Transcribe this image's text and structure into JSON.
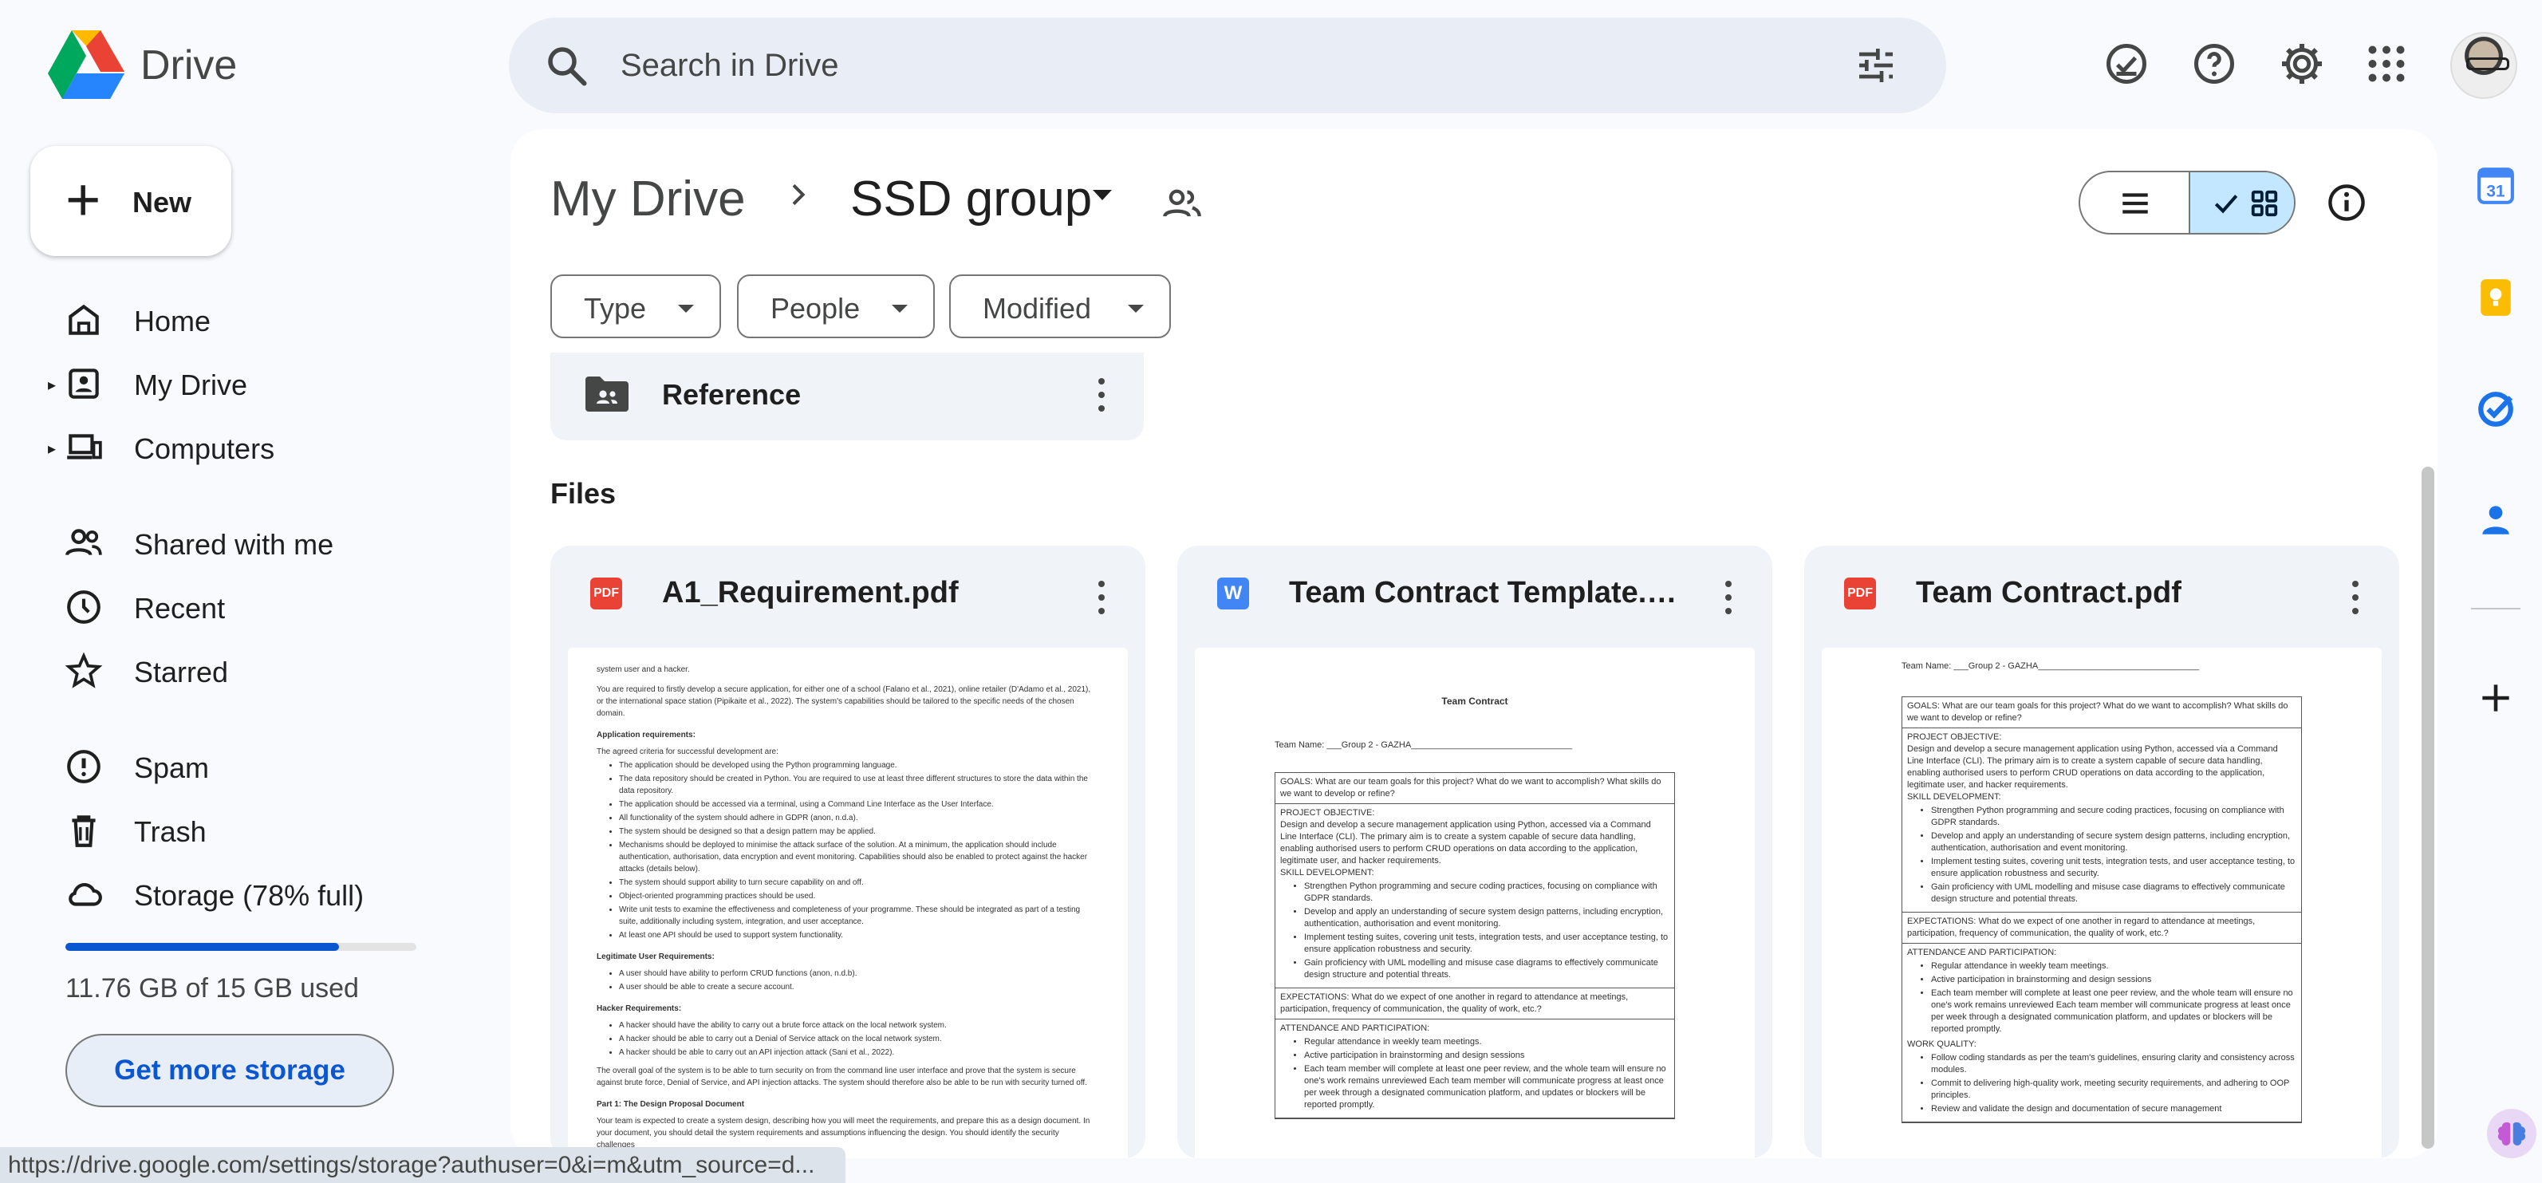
{
  "app": {
    "brand": "Drive"
  },
  "search": {
    "placeholder": "Search in Drive"
  },
  "sidebar": {
    "new_label": "New",
    "items": [
      {
        "label": "Home"
      },
      {
        "label": "My Drive"
      },
      {
        "label": "Computers"
      },
      {
        "label": "Shared with me"
      },
      {
        "label": "Recent"
      },
      {
        "label": "Starred"
      },
      {
        "label": "Spam"
      },
      {
        "label": "Trash"
      },
      {
        "label": "Storage (78% full)"
      }
    ],
    "storage_used_text": "11.76 GB of 15 GB used",
    "storage_percent": 78,
    "get_storage_label": "Get more storage"
  },
  "breadcrumb": {
    "root": "My Drive",
    "current": "SSD group"
  },
  "filters": {
    "type": "Type",
    "people": "People",
    "modified": "Modified"
  },
  "folder": {
    "name": "Reference"
  },
  "files_heading": "Files",
  "files": [
    {
      "name": "A1_Requirement.pdf",
      "kind": "PDF"
    },
    {
      "name": "Team Contract Template.do...",
      "kind": "W"
    },
    {
      "name": "Team Contract.pdf",
      "kind": "PDF"
    }
  ],
  "preview_a1": {
    "p1": "system user and a hacker.",
    "p2": "You are required to firstly develop a secure application, for either one of a school (Falano et al., 2021), online retailer (D'Adamo et al., 2021), or the international space station (Pipikaite et al., 2022). The system's capabilities should be tailored to the specific needs of the chosen domain.",
    "h1": "Application requirements:",
    "p3": "The agreed criteria for successful development are:",
    "l1": [
      "The application should be developed using the Python programming language.",
      "The data repository should be created in Python. You are required to use at least three different structures to store the data within the data repository.",
      "The application should be accessed via a terminal, using a Command Line Interface as the User Interface.",
      "All functionality of the system should adhere in GDPR (anon, n.d.a).",
      "The system should be designed so that a design pattern may be applied.",
      "Mechanisms should be deployed to minimise the attack surface of the solution. At a minimum, the application should include authentication, authorisation, data encryption and event monitoring. Capabilities should also be enabled to protect against the hacker attacks (details below).",
      "The system should support ability to turn secure capability on and off.",
      "Object-oriented programming practices should be used.",
      "Write unit tests to examine the effectiveness and completeness of your programme. These should be integrated as part of a testing suite, additionally including system, integration, and user acceptance.",
      "At least one API should be used to support system functionality."
    ],
    "h2": "Legitimate User Requirements:",
    "l2": [
      "A user should have ability to perform CRUD functions (anon, n.d.b).",
      "A user should be able to create a secure account."
    ],
    "h3": "Hacker Requirements:",
    "l3": [
      "A hacker should have the ability to carry out a brute force attack on the local network system.",
      "A hacker should be able to carry out a Denial of Service attack on the local network system.",
      "A hacker should be able to carry out an API injection attack (Sani et al., 2022)."
    ],
    "p4": "The overall goal of the system is to be able to turn security on from the command line user interface and prove that the system is secure against brute force, Denial of Service, and API injection attacks. The system should therefore also be able to be run with security turned off.",
    "h4": "Part 1: The Design Proposal Document",
    "p5": "Your team is expected to create a system design, describing how you will meet the requirements, and prepare this as a design document. In your document, you should detail the system requirements and assumptions influencing the design. You should identify the security challenges"
  },
  "preview_contract": {
    "title": "Team Contract",
    "team_name": "Team Name: ___Group 2 - GAZHA_________________________________",
    "goals": "GOALS: What are our team goals for this project? What do we want to accomplish? What skills do we want to develop or refine?",
    "objective_h": "PROJECT OBJECTIVE:",
    "objective": "Design and develop a secure management application using Python, accessed via a Command Line Interface (CLI). The primary aim is to create a system capable of secure data handling, enabling authorised users to perform CRUD operations on data according to the application, legitimate user, and hacker requirements.",
    "skills_h": "SKILL DEVELOPMENT:",
    "skills": [
      "Strengthen Python programming and secure coding practices, focusing on compliance with GDPR standards.",
      "Develop and apply an understanding of secure system design patterns, including encryption, authentication, authorisation and event monitoring.",
      "Implement testing suites, covering unit tests, integration tests, and user acceptance testing, to ensure application robustness and security.",
      "Gain proficiency with UML modelling and misuse case diagrams to effectively communicate design structure and potential threats."
    ],
    "expect": "EXPECTATIONS: What do we expect of one another in regard to attendance at meetings, participation, frequency of communication, the quality of work, etc.?",
    "attend_h": "ATTENDANCE AND PARTICIPATION:",
    "attend": [
      "Regular attendance in weekly team meetings.",
      "Active participation in brainstorming and design sessions",
      "Each team member will complete at least one peer review, and the whole team will ensure no one's work remains unreviewed Each team member will communicate progress at least once per week through a designated communication platform, and updates or blockers will be reported promptly."
    ],
    "quality_h": "WORK QUALITY:",
    "quality": [
      "Follow coding standards as per the team's guidelines, ensuring clarity and consistency across modules.",
      "Commit to delivering high-quality work, meeting security requirements, and adhering to OOP principles.",
      "Review and validate the design and documentation of secure management"
    ]
  },
  "status_url": "https://drive.google.com/settings/storage?authuser=0&i=m&utm_source=d...",
  "colors": {
    "accent": "#0b57d0",
    "selected_view": "#c2e7ff",
    "pdf_badge": "#ea4335",
    "word_badge": "#4285f4"
  },
  "icons": {
    "search": "search-icon",
    "tune": "tune-icon",
    "ready_offline": "offline-check-icon",
    "help": "help-icon",
    "settings": "gear-icon",
    "apps": "apps-grid-icon",
    "calendar": "calendar-icon",
    "keep": "keep-icon",
    "tasks": "tasks-icon",
    "contacts": "contacts-icon"
  }
}
